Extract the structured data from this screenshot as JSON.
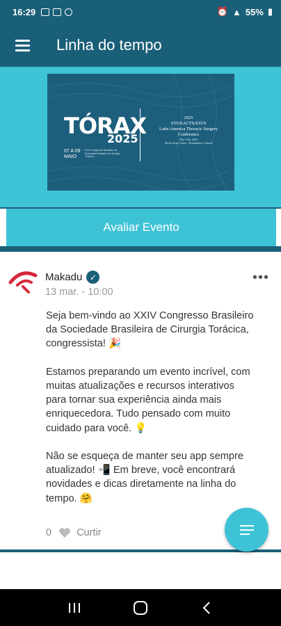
{
  "status_bar": {
    "time": "16:29",
    "battery": "55%"
  },
  "app_bar": {
    "title": "Linha do tempo",
    "menu_icon": "hamburger-icon"
  },
  "banner": {
    "title": "TÓRAX",
    "year": "2025",
    "date_line1": "07 A 09",
    "date_line2": "MAIO",
    "small_text": "XXIV Congresso Brasileiro da Sociedade Brasileira de Cirurgia Torácica",
    "right_year": "2025",
    "right_line1": "STS/EACTS/ESTS",
    "right_line2": "Latin America Thoracic Surgery",
    "right_line3": "Conference",
    "right_date": "May 10th, 2025",
    "right_place": "Recife Expo Center • Pernambuco • Brazil"
  },
  "evaluate_button": {
    "label": "Avaliar Evento"
  },
  "post": {
    "author": "Makadu",
    "date": "13 mar. - 10:00",
    "more_icon": "•••",
    "paragraph1": "Seja bem-vindo ao XXIV Congresso Brasileiro da Sociedade Brasileira de Cirurgia Torácica, congressista! 🎉",
    "paragraph2": "Estamos preparando um evento incrível, com muitas atualizações e recursos interativos para tornar sua experiência ainda mais enriquecedora. Tudo pensado com muito cuidado para você. 💡",
    "paragraph3": "Não se esqueça de manter seu app sempre atualizado! 📲 Em breve, você encontrará novidades e dicas diretamente na linha do tempo. 🤗",
    "like_count": "0",
    "like_label": "Curtir"
  },
  "colors": {
    "primary_dark": "#1a5f78",
    "accent": "#3ec3d6"
  }
}
